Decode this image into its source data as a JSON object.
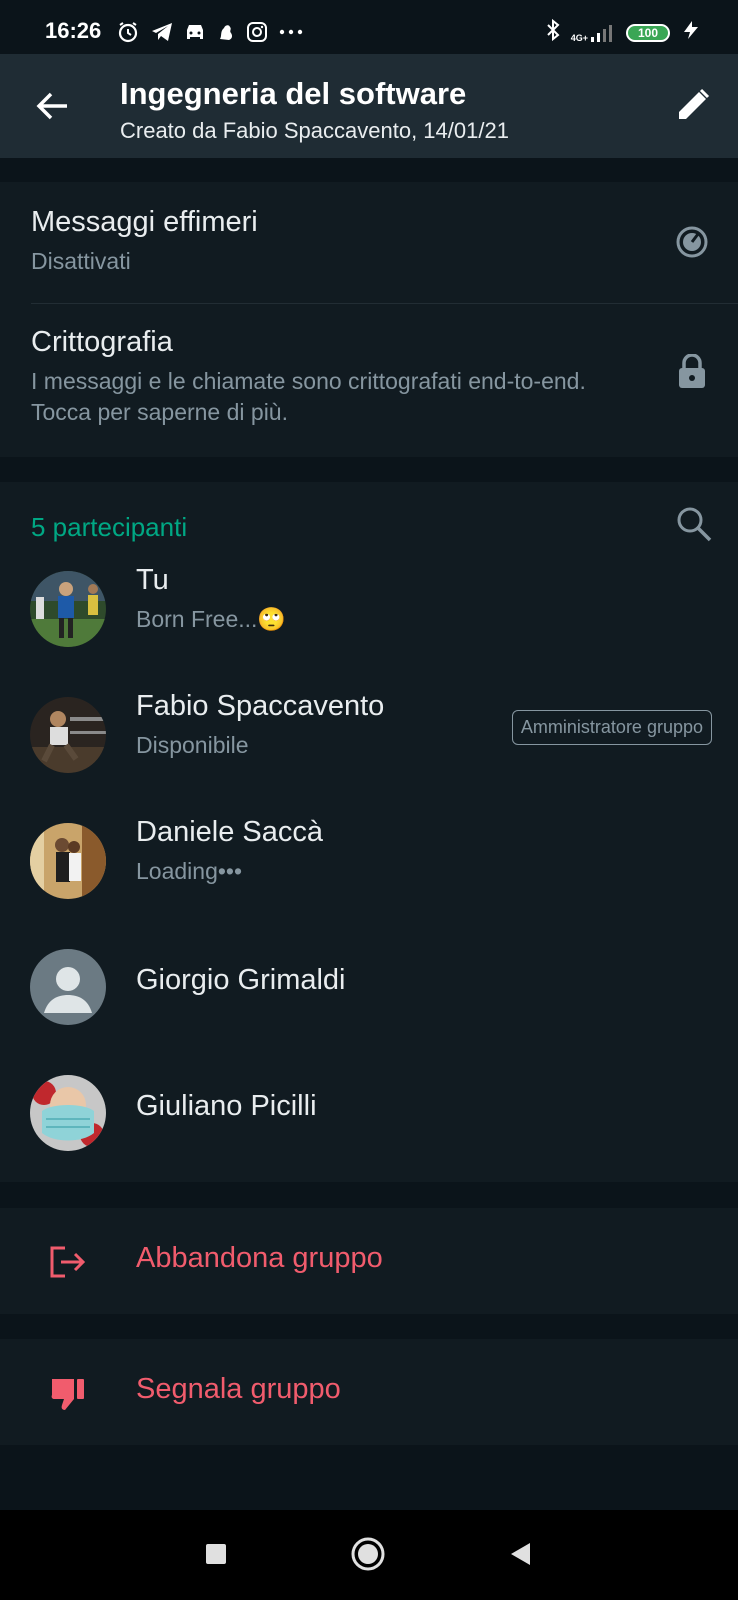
{
  "status_bar": {
    "time": "16:26",
    "network": "4G+",
    "battery": "100",
    "icons": [
      "alarm-icon",
      "telegram-icon",
      "car-icon",
      "notification-icon",
      "instagram-icon",
      "more-icon",
      "bluetooth-icon",
      "signal-icon",
      "charging-icon"
    ]
  },
  "header": {
    "title": "Ingegneria del software",
    "subtitle": "Creato da Fabio Spaccavento, 14/01/21",
    "back_icon": "arrow-left-icon",
    "edit_icon": "pencil-icon"
  },
  "settings": [
    {
      "title": "Messaggi effimeri",
      "subtitle": "Disattivati",
      "icon": "timer-icon"
    },
    {
      "title": "Crittografia",
      "subtitle": "I messaggi e le chiamate sono crittografati end-to-end. Tocca per saperne di più.",
      "icon": "lock-icon"
    }
  ],
  "participants": {
    "header": "5 partecipanti",
    "search_icon": "search-icon",
    "list": [
      {
        "name": "Tu",
        "status": "Born Free...🙄",
        "badge": ""
      },
      {
        "name": "Fabio Spaccavento",
        "status": "Disponibile",
        "badge": "Amministratore gruppo"
      },
      {
        "name": "Daniele Saccà",
        "status": "Loading•••",
        "badge": ""
      },
      {
        "name": "Giorgio Grimaldi",
        "status": "",
        "badge": ""
      },
      {
        "name": "Giuliano Picilli",
        "status": "",
        "badge": ""
      }
    ]
  },
  "actions": {
    "exit_label": "Abbandona gruppo",
    "report_label": "Segnala gruppo",
    "color": "#f15c6d"
  },
  "colors": {
    "background": "#0b141a",
    "card": "#111b21",
    "header": "#1f2c34",
    "accent": "#00a884",
    "secondary_text": "#8696a0"
  },
  "nav_bar": {
    "icons": [
      "recents-square-icon",
      "home-circle-icon",
      "back-triangle-icon"
    ]
  }
}
